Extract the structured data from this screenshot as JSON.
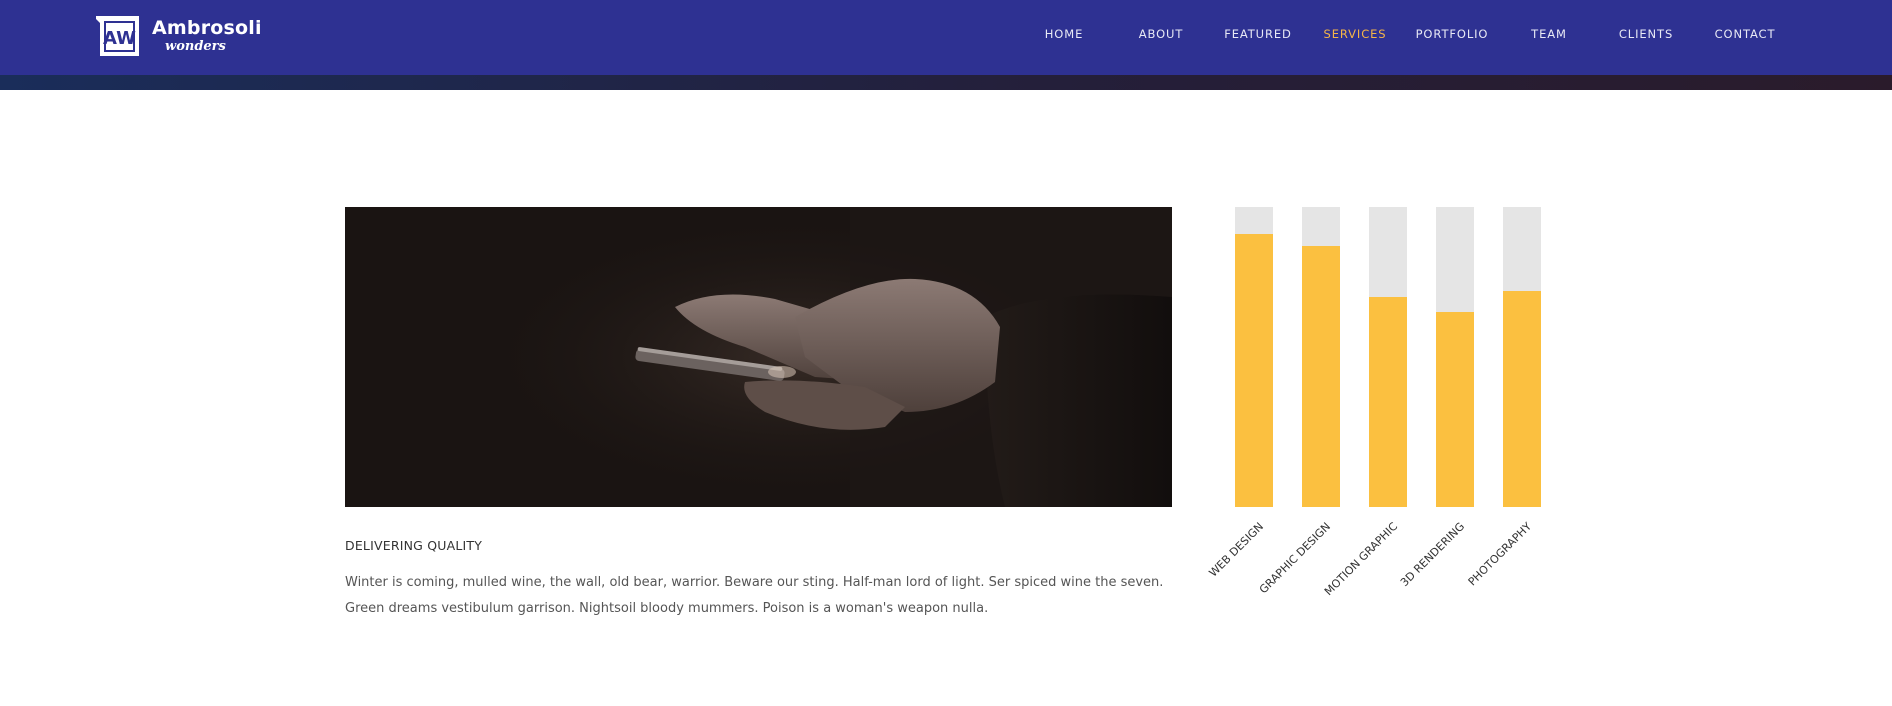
{
  "brand": {
    "name": "Ambrosoli",
    "tagline": "wonders",
    "monogram": "AW",
    "bar_color": "#2e3192"
  },
  "nav": {
    "items": [
      {
        "label": "HOME"
      },
      {
        "label": "ABOUT"
      },
      {
        "label": "FEATURED"
      },
      {
        "label": "SERVICES",
        "active": true
      },
      {
        "label": "PORTFOLIO"
      },
      {
        "label": "TEAM"
      },
      {
        "label": "CLIENTS"
      },
      {
        "label": "CONTACT"
      }
    ],
    "active_color": "#f5b548"
  },
  "section": {
    "heading": "DELIVERING QUALITY",
    "body": "Winter is coming, mulled wine, the wall, old bear, warrior. Beware our sting. Half-man lord of light. Ser spiced wine the seven. Green dreams vestibulum garrison. Nightsoil bloody mummers. Poison is a woman's weapon nulla."
  },
  "hero_image": {
    "subject": "hands holding a smartphone in the dark"
  },
  "chart_data": {
    "type": "bar",
    "categories": [
      "WEB DESIGN",
      "GRAPHIC DESIGN",
      "MOTION GRAPHIC",
      "3D RENDERING",
      "PHOTOGRAPHY"
    ],
    "values": [
      91,
      87,
      70,
      65,
      72
    ],
    "ylim": [
      0,
      100
    ],
    "bar_color": "#fbc040",
    "track_color": "#e5e5e5"
  }
}
